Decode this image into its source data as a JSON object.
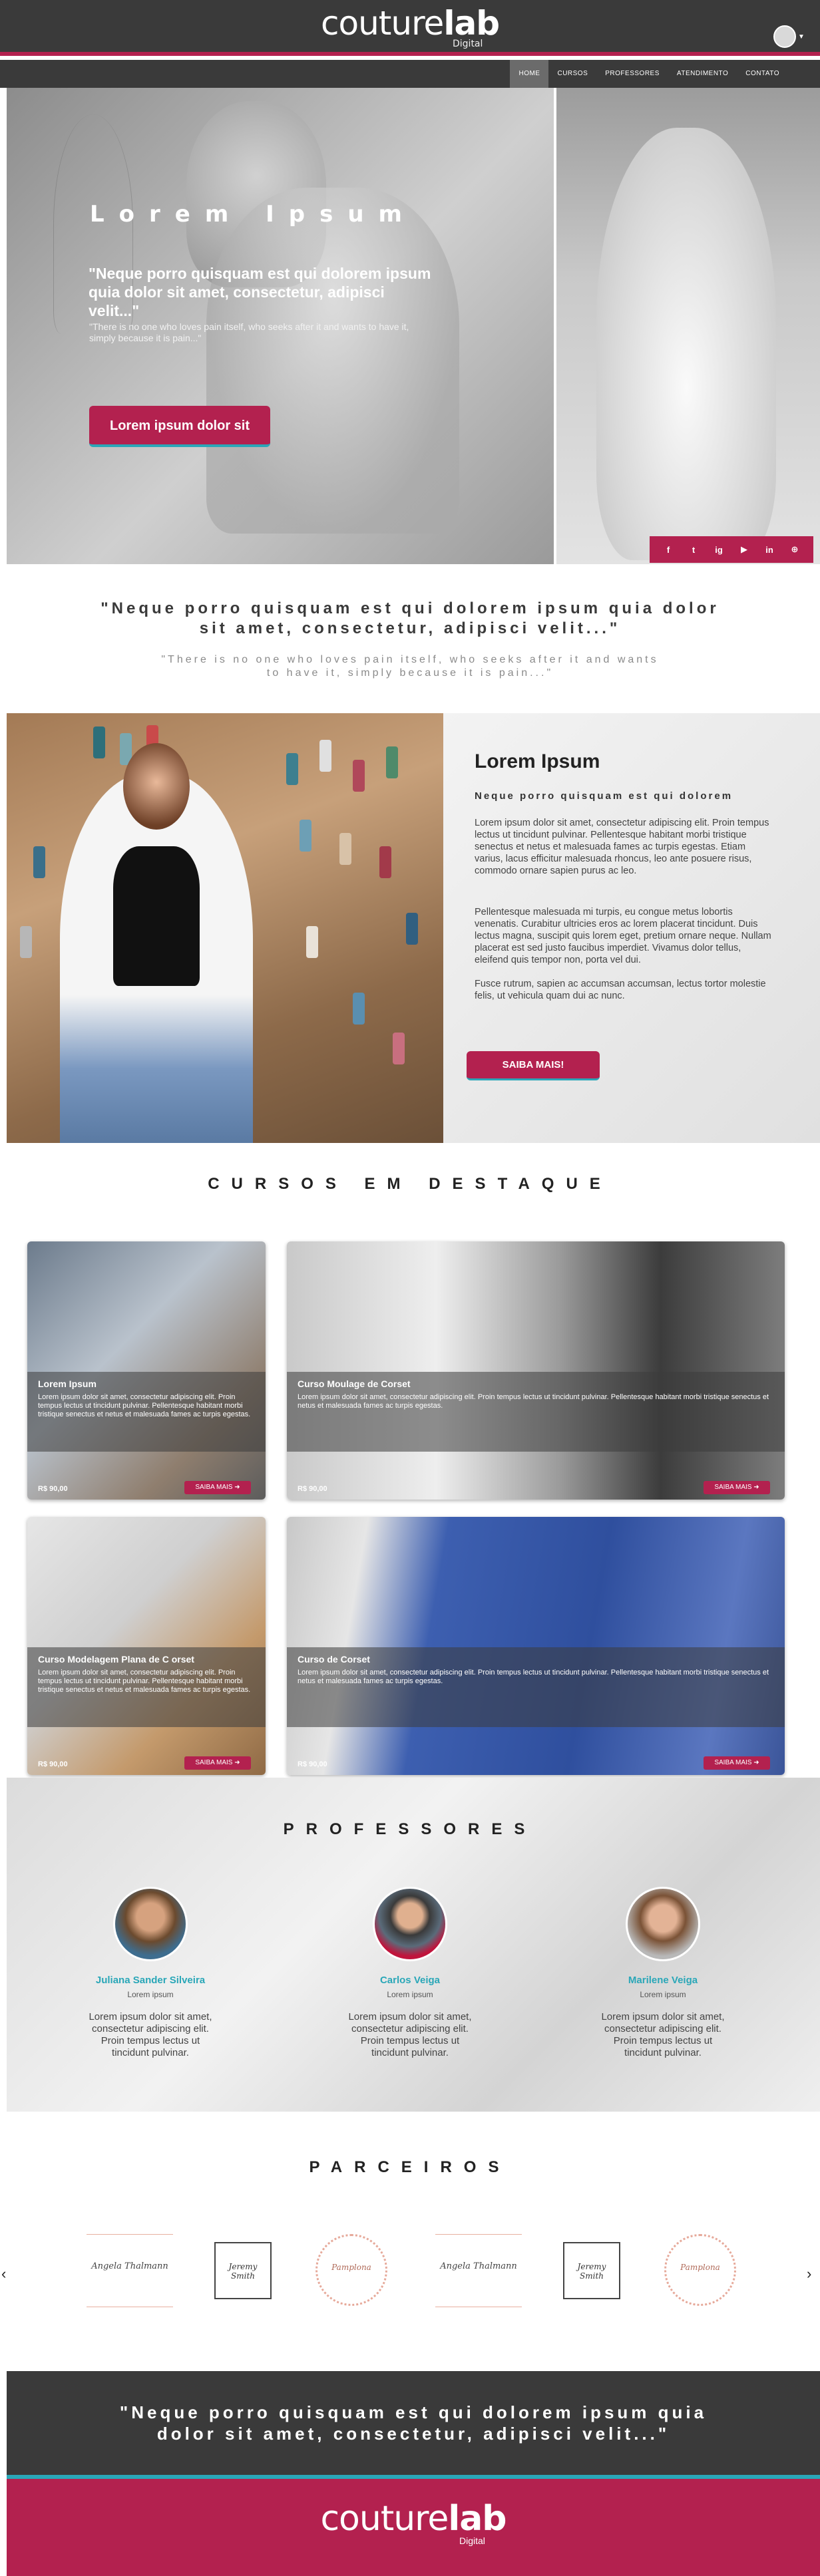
{
  "header": {
    "logo_light": "couture",
    "logo_bold": "lab",
    "logo_sub": "Digital",
    "nav": [
      "HOME",
      "CURSOS",
      "PROFESSORES",
      "ATENDIMENTO",
      "CONTATO"
    ]
  },
  "hero": {
    "title": "Lorem Ipsum",
    "quote": "\"Neque porro quisquam est qui dolorem ipsum quia dolor sit amet, consectetur, adipisci velit...\"",
    "subtext": "\"There is no one who loves pain itself, who seeks after it and wants to have it, simply because it is pain...\"",
    "button": "Lorem ipsum dolor sit",
    "social": [
      "f",
      "t",
      "ig",
      "▶",
      "in",
      "⊕"
    ]
  },
  "quote_section": {
    "main": "\"Neque porro quisquam est qui dolorem ipsum quia dolor sit amet, consectetur, adipisci velit...\"",
    "small": "\"There is no one who loves pain itself, who seeks after it and wants to have it, simply because it is pain...\""
  },
  "about": {
    "title": "Lorem Ipsum",
    "subtitle": "Neque porro quisquam est qui dolorem",
    "p1": "Lorem ipsum dolor sit amet, consectetur adipiscing elit. Proin tempus lectus ut tincidunt pulvinar. Pellentesque habitant morbi tristique senectus et netus et malesuada fames ac turpis egestas. Etiam varius, lacus efficitur malesuada rhoncus, leo ante posuere risus, commodo ornare sapien purus ac leo.",
    "p2": "Pellentesque malesuada mi turpis, eu congue metus lobortis venenatis. Curabitur ultricies eros ac lorem placerat tincidunt. Duis lectus magna, suscipit quis lorem eget, pretium ornare neque. Nullam placerat est sed justo faucibus imperdiet. Vivamus dolor tellus, eleifend quis tempor non, porta vel dui.",
    "p3": "Fusce rutrum, sapien ac accumsan accumsan, lectus tortor molestie felis, ut vehicula quam dui ac nunc.",
    "button": "SAIBA MAIS!"
  },
  "courses": {
    "title": "CURSOS EM DESTAQUE",
    "items": [
      {
        "title": "Lorem Ipsum",
        "desc": "Lorem ipsum dolor sit amet, consectetur adipiscing elit. Proin tempus lectus ut tincidunt pulvinar. Pellentesque habitant morbi tristique senectus et netus et malesuada fames ac turpis egestas.",
        "price": "R$ 90,00",
        "button": "SAIBA MAIS"
      },
      {
        "title": "Curso Moulage de Corset",
        "desc": "Lorem ipsum dolor sit amet, consectetur adipiscing elit. Proin tempus lectus ut tincidunt pulvinar. Pellentesque habitant morbi tristique senectus et netus et malesuada fames ac turpis egestas.",
        "price": "R$ 90,00",
        "button": "SAIBA MAIS"
      },
      {
        "title": "Curso Modelagem Plana de C orset",
        "desc": "Lorem ipsum dolor sit amet, consectetur adipiscing elit. Proin tempus lectus ut tincidunt pulvinar. Pellentesque habitant morbi tristique senectus et netus et malesuada fames ac turpis egestas.",
        "price": "R$ 90,00",
        "button": "SAIBA MAIS"
      },
      {
        "title": "Curso de Corset",
        "desc": "Lorem ipsum dolor sit amet, consectetur adipiscing elit. Proin tempus lectus ut tincidunt pulvinar. Pellentesque habitant morbi tristique senectus et netus et malesuada fames ac turpis egestas.",
        "price": "R$ 90,00",
        "button": "SAIBA MAIS"
      }
    ]
  },
  "professores": {
    "title": "PROFESSORES",
    "items": [
      {
        "name": "Juliana Sander Silveira",
        "role": "Lorem ipsum",
        "desc": "Lorem ipsum dolor sit amet, consectetur adipiscing elit. Proin tempus lectus ut tincidunt pulvinar."
      },
      {
        "name": "Carlos Veiga",
        "role": "Lorem ipsum",
        "desc": "Lorem ipsum dolor sit amet, consectetur adipiscing elit. Proin tempus lectus ut tincidunt pulvinar."
      },
      {
        "name": "Marilene Veiga",
        "role": "Lorem ipsum",
        "desc": "Lorem ipsum dolor sit amet, consectetur adipiscing elit. Proin tempus lectus ut tincidunt pulvinar."
      }
    ]
  },
  "parceiros": {
    "title": "PARCEIROS",
    "logos": [
      "Angela Thalmann",
      "Jeremy Smith",
      "Pamplona",
      "Angela Thalmann",
      "Jeremy Smith",
      "Pamplona"
    ],
    "prev": "‹",
    "next": "›"
  },
  "footer": {
    "quote": "\"Neque porro quisquam est qui dolorem ipsum quia dolor sit amet, consectetur, adipisci velit...\"",
    "logo_light": "couture",
    "logo_bold": "lab",
    "logo_sub": "Digital"
  },
  "colors": {
    "primary": "#b3214f",
    "accent": "#2aa7b8",
    "dark": "#3a3a3a"
  }
}
